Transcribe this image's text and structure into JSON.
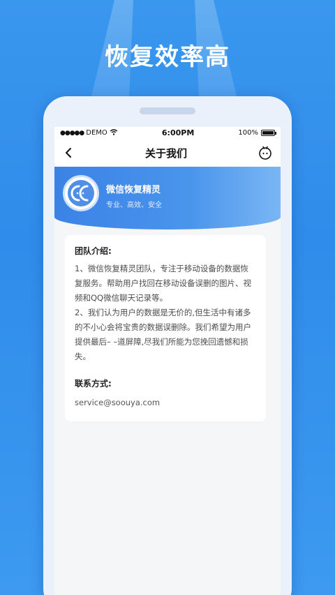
{
  "promo": {
    "headline": "恢复效率高"
  },
  "statusbar": {
    "signal": "●●●●●",
    "carrier": "DEMO",
    "time": "6:00PM",
    "battery_text": "100%",
    "battery_level": 1.0
  },
  "navbar": {
    "title": "关于我们"
  },
  "banner": {
    "logo_text": "CC",
    "app_name": "微信恢复精灵",
    "tagline": "专业、高效、安全"
  },
  "card": {
    "intro_heading": "团队介绍:",
    "paragraph1": "1、微信恢复精灵团队，专注于移动设备的数据恢复服务。帮助用户找回在移动设备误删的图片、视频和QQ微信聊天记录等。",
    "paragraph2": "2、我们认为用户的数据是无价的,但生活中有诸多的不小心会将宝贵的数据误删除。我们希望为用户提供最后– –道屏障,尽我们所能为您挽回遗憾和损失。",
    "contact_heading": "联系方式:",
    "email": "service@soouya.com"
  },
  "colors": {
    "background": "#2f8cea",
    "accent": "#3b82e6",
    "banner_light": "#7ab6f4"
  },
  "icons": {
    "back": "chevron-left-icon",
    "robot": "robot-face-icon",
    "wifi": "wifi-icon",
    "battery": "battery-icon"
  }
}
